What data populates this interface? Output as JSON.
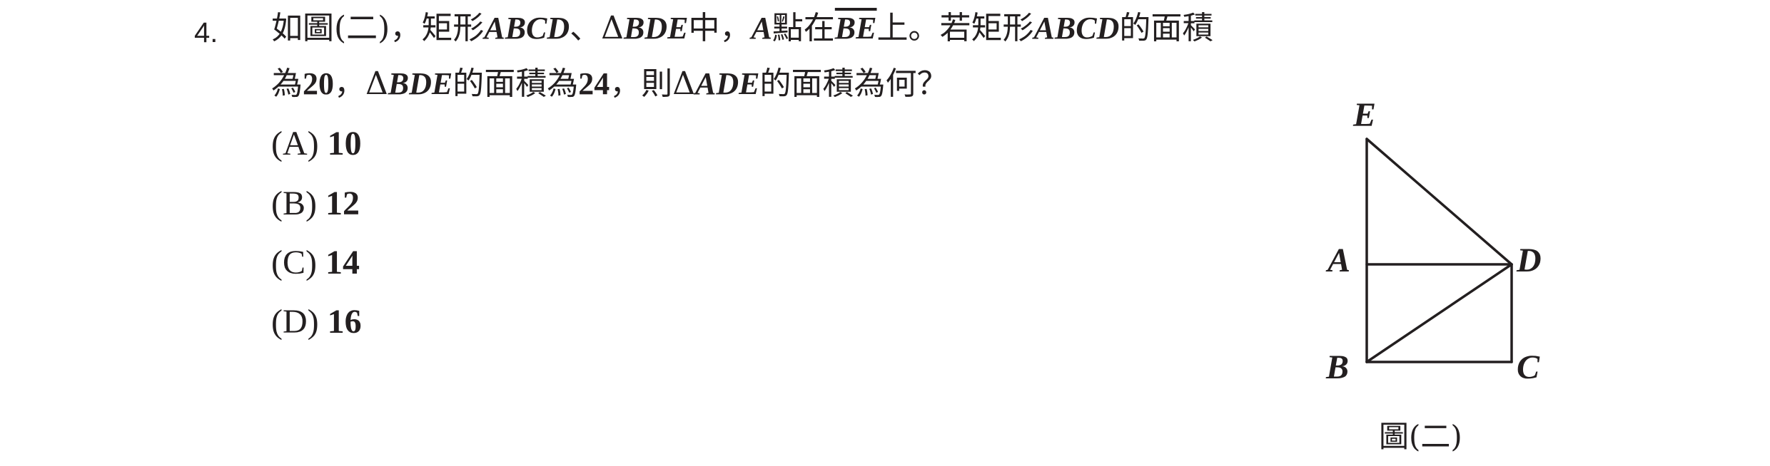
{
  "question": {
    "number": "4.",
    "line1": {
      "t1": "如圖(二)，矩形",
      "v1": "ABCD",
      "t2": "、Δ",
      "v2": "BDE",
      "t3": "中，",
      "v3": "A",
      "t4": "點在",
      "v4": "BE",
      "t5": "上。若矩形",
      "v5": "ABCD",
      "t6": "的面積"
    },
    "line2": {
      "t1": "為",
      "n1": "20",
      "t2": "，Δ",
      "v1": "BDE",
      "t3": "的面積為",
      "n2": "24",
      "t4": "，則Δ",
      "v2": "ADE",
      "t5": "的面積為何？"
    },
    "options": [
      {
        "label": "(A)",
        "value": "10"
      },
      {
        "label": "(B)",
        "value": "12"
      },
      {
        "label": "(C)",
        "value": "14"
      },
      {
        "label": "(D)",
        "value": "16"
      }
    ]
  },
  "figure": {
    "caption": "圖(二)",
    "vertices": {
      "E": "E",
      "A": "A",
      "D": "D",
      "B": "B",
      "C": "C"
    }
  }
}
